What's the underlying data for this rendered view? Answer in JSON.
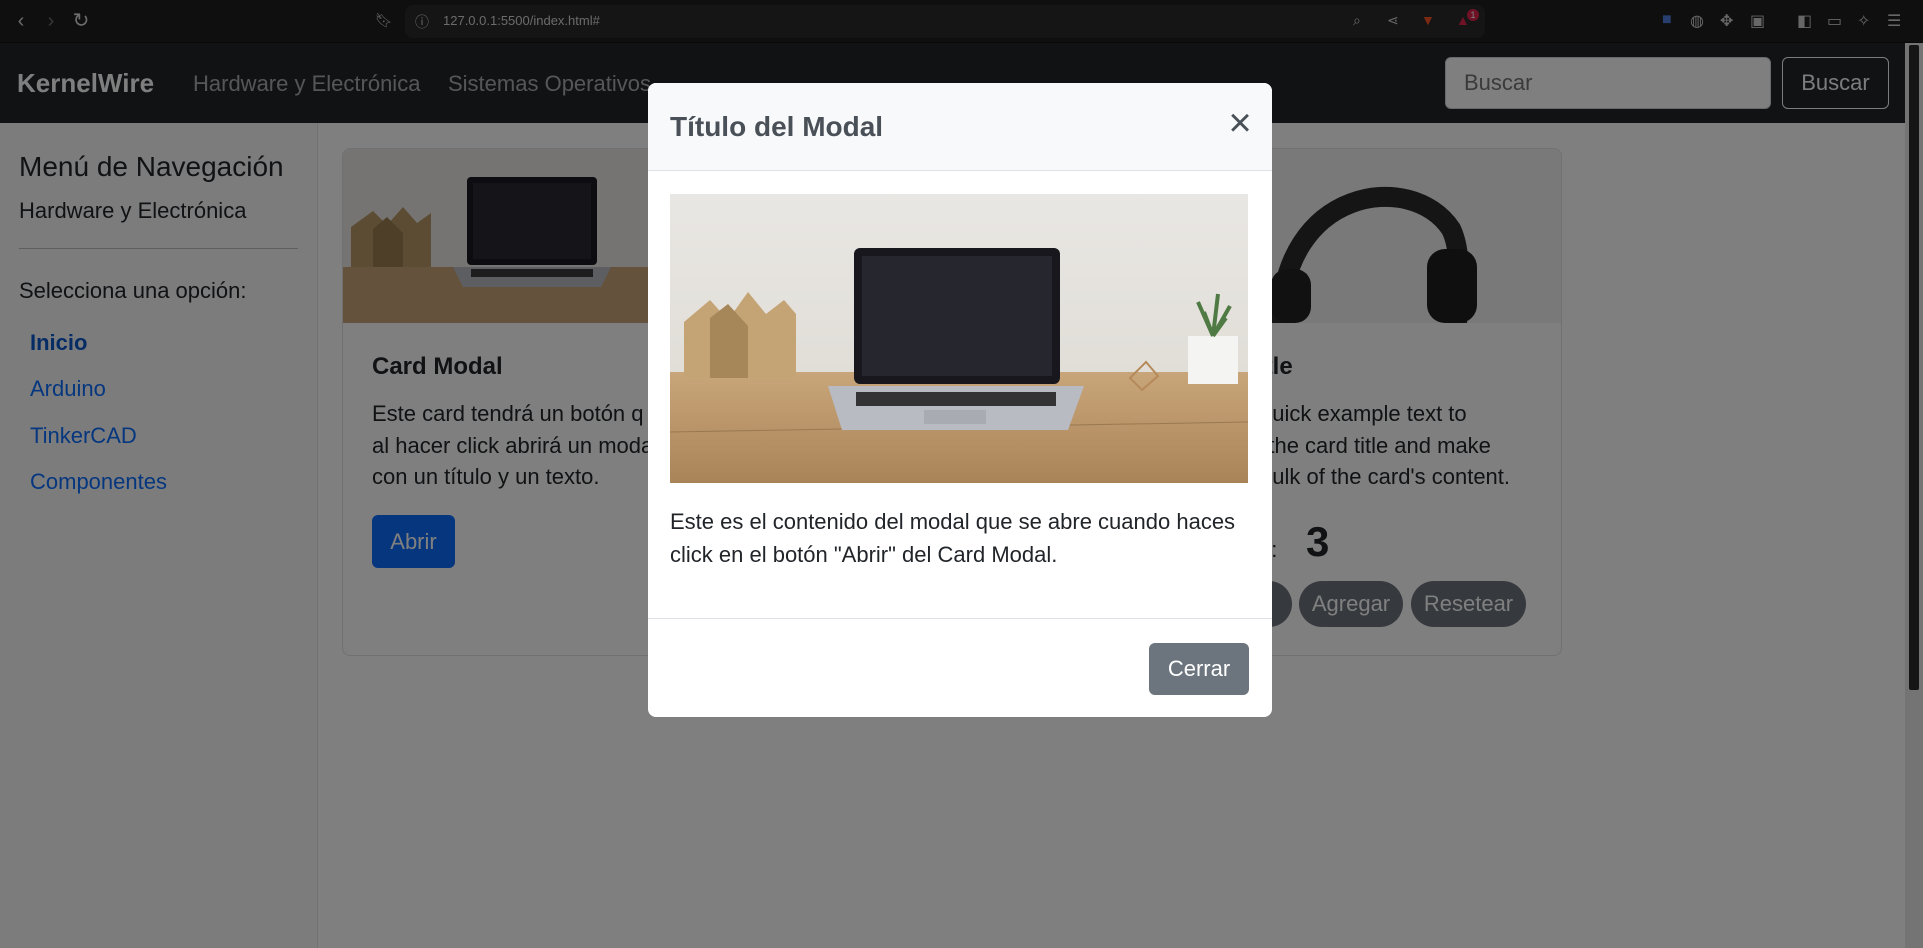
{
  "browser": {
    "url": "127.0.0.1:5500/index.html#",
    "back_icon": "chevron-left-icon",
    "forward_icon": "chevron-right-icon",
    "reload_icon": "reload-icon",
    "bookmark_icon": "bookmark-icon",
    "info_icon": "info-icon",
    "zoom_icon": "zoom-icon",
    "share_icon": "share-icon",
    "brave_icon": "brave-lion-icon",
    "rewards_badge": "1"
  },
  "navbar": {
    "brand": "KernelWire",
    "links": [
      "Hardware y Electrónica",
      "Sistemas Operativos"
    ],
    "search_placeholder": "Buscar",
    "search_button": "Buscar"
  },
  "sidebar": {
    "title": "Menú de Navegación",
    "subtitle": "Hardware y Electrónica",
    "prompt": "Selecciona una opción:",
    "items": [
      {
        "label": "Inicio",
        "active": true
      },
      {
        "label": "Arduino",
        "active": false
      },
      {
        "label": "TinkerCAD",
        "active": false
      },
      {
        "label": "Componentes",
        "active": false
      }
    ]
  },
  "cards": {
    "modal_card": {
      "title": "Card Modal",
      "text_lines": [
        "Este card tendrá un botón q",
        "al hacer click abrirá un moda",
        "con un título y un texto."
      ],
      "button": "Abrir"
    },
    "counter_card": {
      "title": "title",
      "text_lines": [
        "quick example text to",
        "n the card title and make",
        "bulk of the card's content."
      ],
      "counter_label": "as:",
      "counter_value": "3",
      "buttons": [
        "r",
        "Agregar",
        "Resetear"
      ]
    }
  },
  "modal": {
    "title": "Título del Modal",
    "body_text": "Este es el contenido del modal que se abre cuando haces click en el botón \"Abrir\" del Card Modal.",
    "close_button": "Cerrar",
    "close_icon": "close-x-icon"
  },
  "colors": {
    "navbar_bg": "#212529",
    "primary": "#0d6efd",
    "secondary": "#6c757d",
    "backdrop": "rgba(0,0,0,0.5)"
  }
}
